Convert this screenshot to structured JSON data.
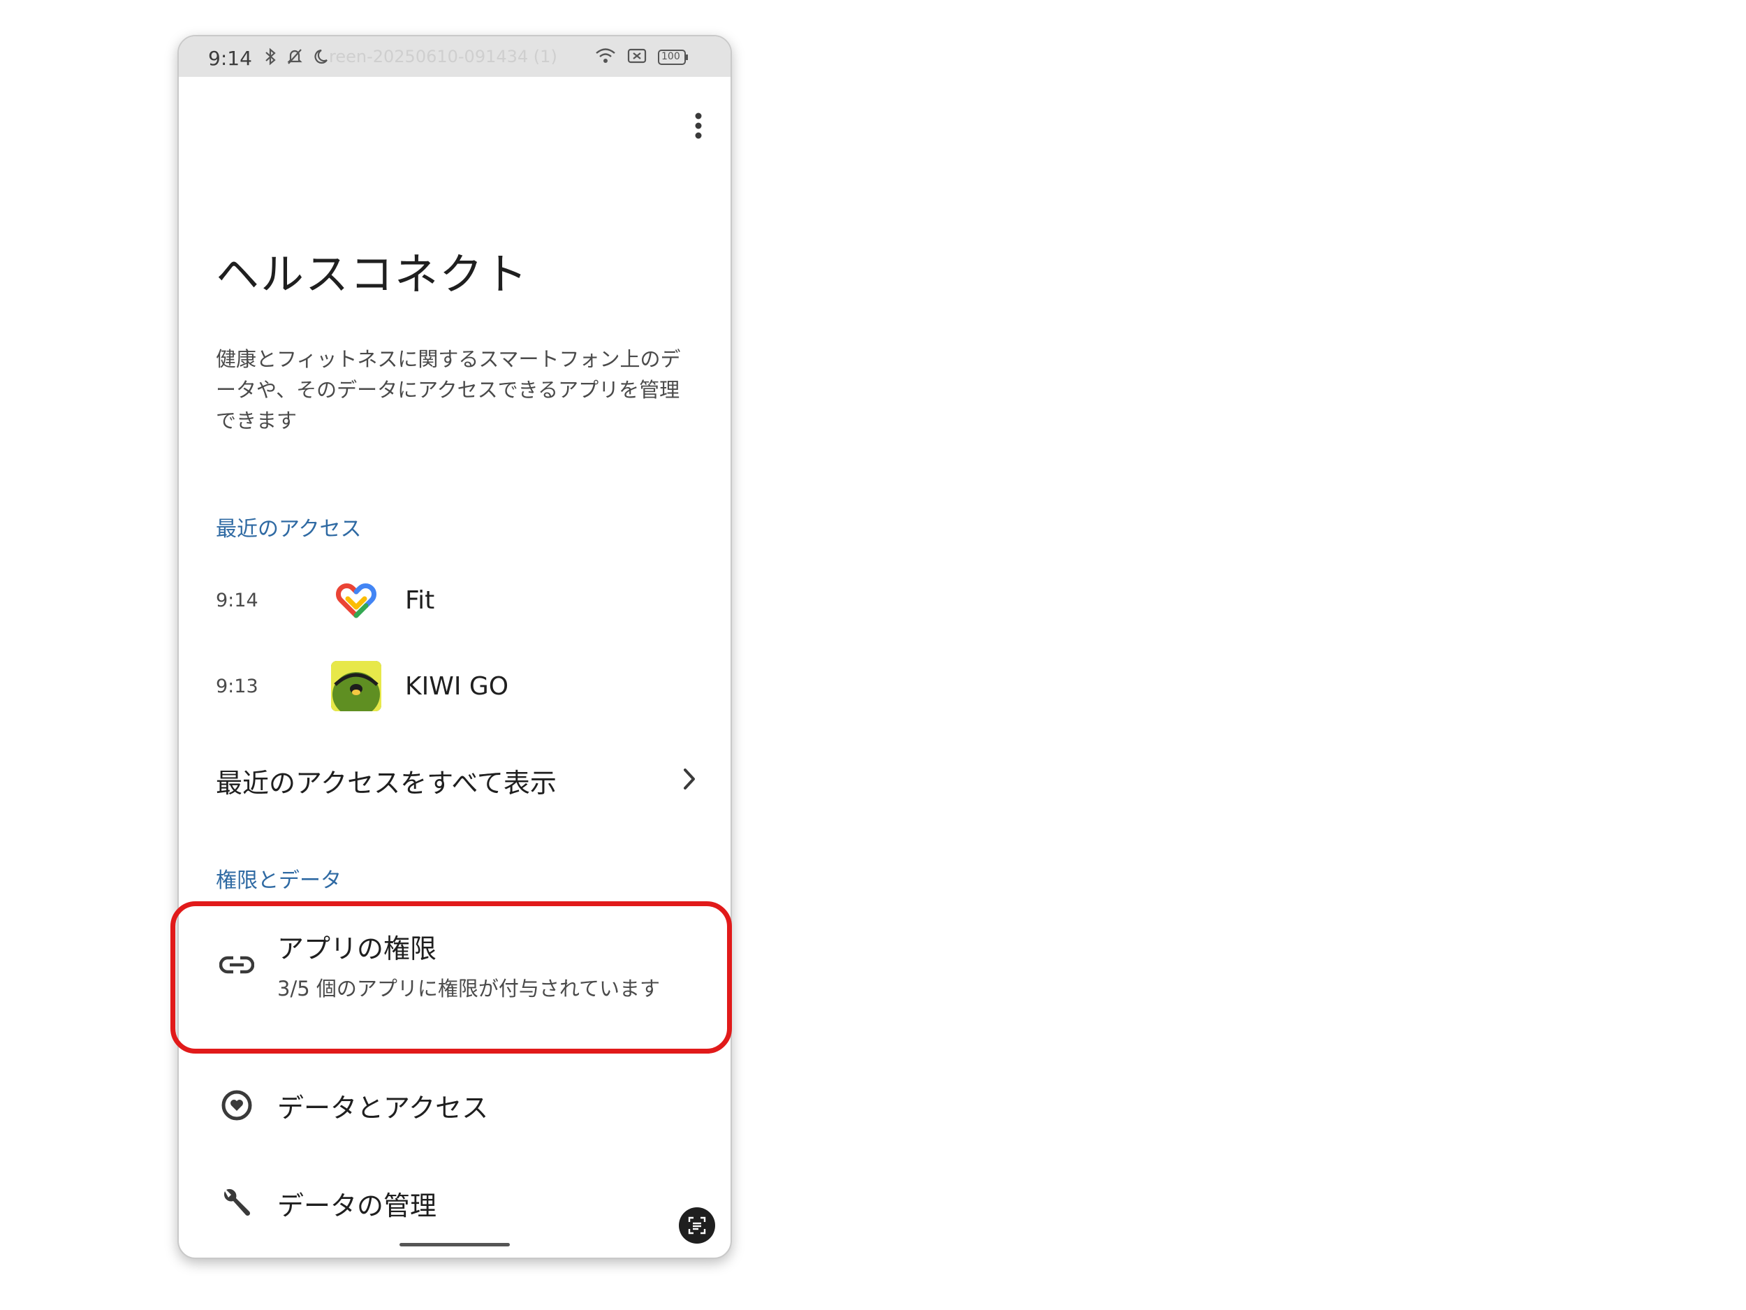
{
  "status_bar": {
    "time": "9:14",
    "file_overlay": "reen-20250610-091434 (1)",
    "battery": "100",
    "icons": [
      "bluetooth-icon",
      "bell-off-icon",
      "moon-icon",
      "wifi-icon",
      "sim-off-icon",
      "battery-icon"
    ]
  },
  "header": {
    "more_icon": "more-vert-icon"
  },
  "page": {
    "title": "ヘルスコネクト",
    "description": "健康とフィットネスに関するスマートフォン上のデータや、そのデータにアクセスできるアプリを管理できます"
  },
  "recent_access": {
    "section_label": "最近のアクセス",
    "items": [
      {
        "time": "9:14",
        "app": "Fit",
        "icon": "google-fit-icon"
      },
      {
        "time": "9:13",
        "app": "KIWI GO",
        "icon": "kiwi-go-icon"
      }
    ],
    "view_all_label": "最近のアクセスをすべて表示"
  },
  "permissions": {
    "section_label": "権限とデータ",
    "items": [
      {
        "title": "アプリの権限",
        "subtitle": "3/5 個のアプリに権限が付与されています",
        "icon": "link-icon"
      },
      {
        "title": "データとアクセス",
        "icon": "data-access-icon"
      },
      {
        "title": "データの管理",
        "icon": "wrench-icon"
      }
    ]
  },
  "colors": {
    "accent": "#2f6aa3",
    "highlight": "#e11a1a",
    "status_bar_bg": "#e3e3e3"
  }
}
